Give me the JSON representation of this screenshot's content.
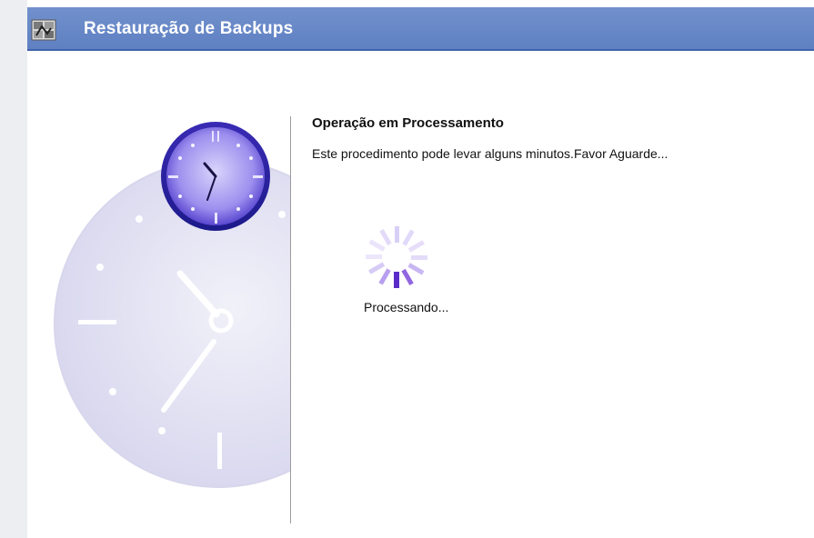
{
  "window": {
    "title": "Restauração de Backups",
    "title_icon": "backup-restore-icon",
    "titlebar_color": "#6384c5"
  },
  "content": {
    "heading": "Operação em Processamento",
    "message": "Este procedimento pode levar alguns minutos.Favor Aguarde...",
    "status_text": "Processando...",
    "spinner_icon": "loading-spinner-icon",
    "illustration_icon": "clock-icon",
    "accent_color": "#5b2bc9"
  }
}
